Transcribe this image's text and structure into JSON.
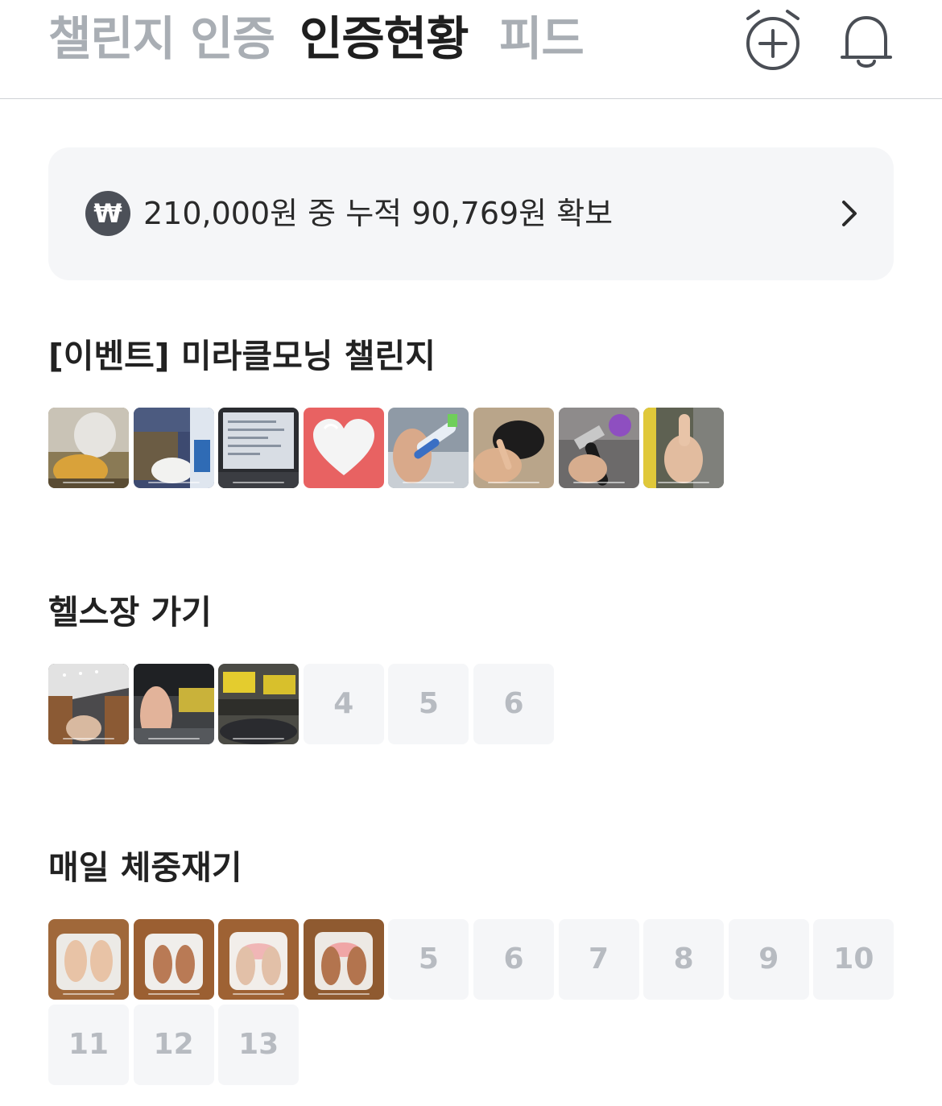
{
  "header": {
    "tabs": [
      {
        "label": "챌린지 인증",
        "active": false
      },
      {
        "label": "인증현황",
        "active": true
      },
      {
        "label": "피드",
        "active": false
      }
    ],
    "icons": [
      "alarm-add-icon",
      "bell-icon"
    ]
  },
  "deposit": {
    "currency_symbol": "₩",
    "text": "210,000원 중 누적 90,769원 확보"
  },
  "challenges": [
    {
      "title": "[이벤트] 미라클모닝 챌린지",
      "photos": 8,
      "slots": []
    },
    {
      "title": "헬스장 가기",
      "photos": 3,
      "slots": [
        "4",
        "5",
        "6"
      ]
    },
    {
      "title": "매일 체중재기",
      "photos": 4,
      "slots": [
        "5",
        "6",
        "7",
        "8",
        "9",
        "10",
        "11",
        "12",
        "13"
      ]
    }
  ],
  "colors": {
    "active_tab": "#1f1f1f",
    "inactive_tab": "#a9aeb4",
    "banner_bg": "#f5f6f8",
    "empty_slot_bg": "#f5f6f8",
    "empty_slot_text": "#b7bbc1",
    "won_badge": "#4c5058",
    "heart_bg": "#e86262"
  }
}
